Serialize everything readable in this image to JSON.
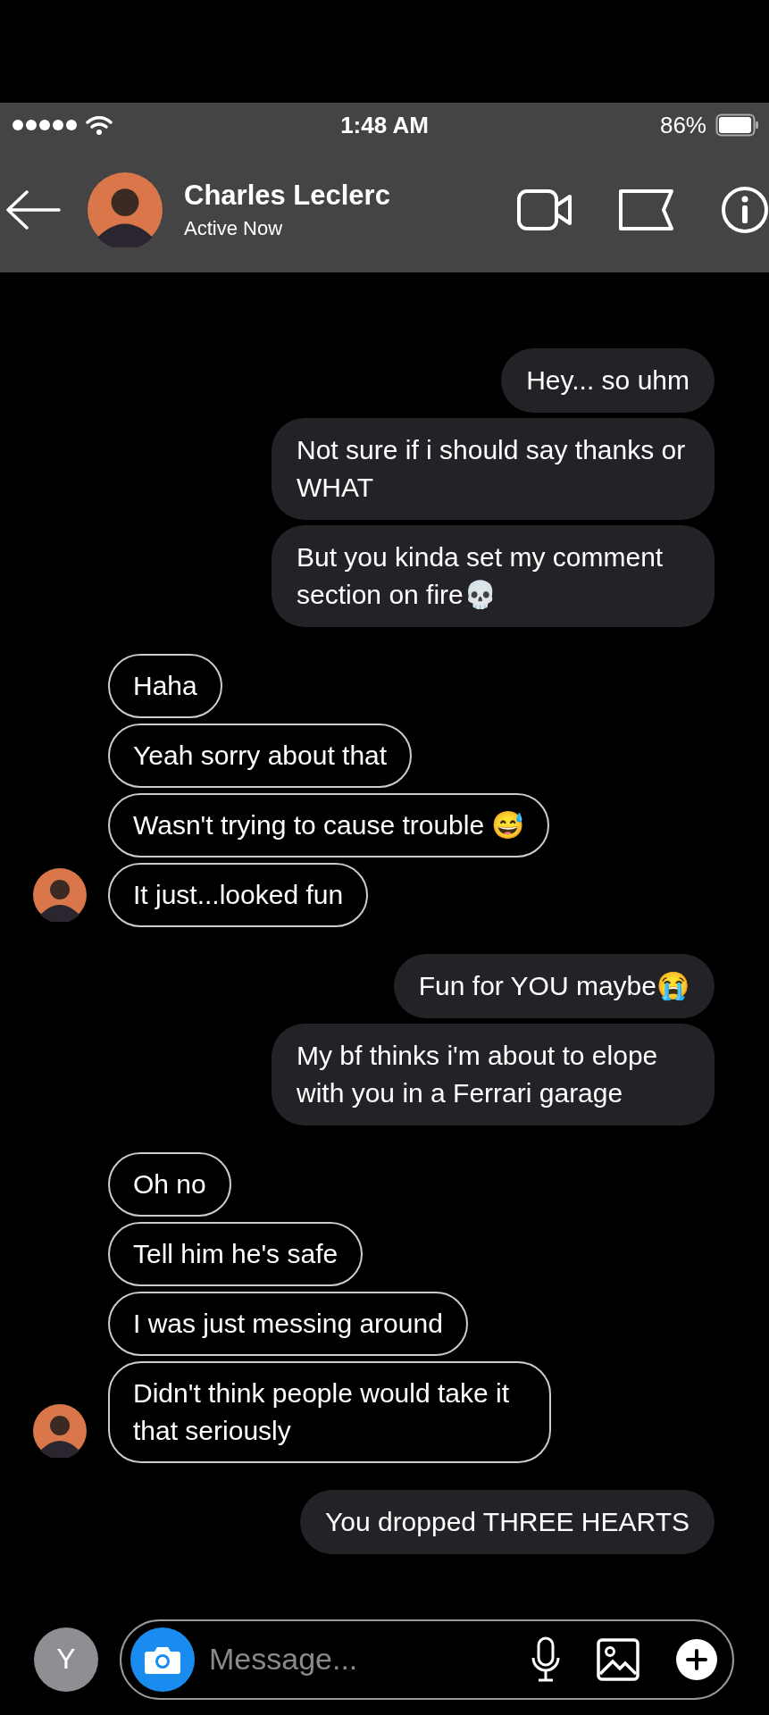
{
  "status_bar": {
    "time": "1:48 AM",
    "battery": "86%"
  },
  "header": {
    "name": "Charles Leclerc",
    "status": "Active Now"
  },
  "groups": [
    {
      "kind": "sent",
      "messages": [
        "Hey... so uhm",
        "Not sure if i should say thanks or WHAT",
        "But you kinda set my comment section on fire💀"
      ]
    },
    {
      "kind": "received",
      "messages": [
        "Haha",
        "Yeah sorry about that",
        "Wasn't trying to cause trouble 😅",
        "It just...looked fun"
      ]
    },
    {
      "kind": "sent",
      "messages": [
        "Fun for YOU maybe😭",
        "My bf thinks i'm about to elope with you in a Ferrari garage"
      ]
    },
    {
      "kind": "received",
      "messages": [
        "Oh no",
        "Tell him he's safe",
        "I was just messing around",
        "Didn't think people would take it that seriously"
      ]
    },
    {
      "kind": "sent",
      "messages": [
        "You dropped THREE HEARTS"
      ]
    }
  ],
  "composer": {
    "user_initial": "Y",
    "placeholder": "Message..."
  }
}
